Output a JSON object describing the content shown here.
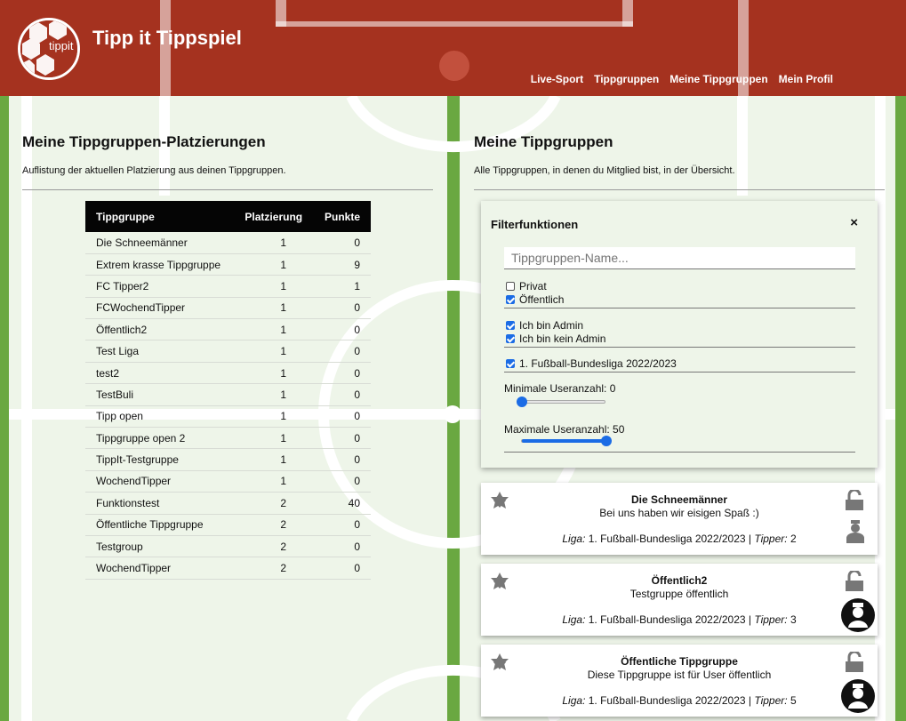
{
  "header": {
    "brand": "Tipp it Tippspiel",
    "logo_text": "tippit",
    "nav": [
      "Live-Sport",
      "Tippgruppen",
      "Meine Tippgruppen",
      "Mein Profil"
    ]
  },
  "left": {
    "title": "Meine Tippgruppen-Platzierungen",
    "subtitle": "Auflistung der aktuellen Platzierung aus deinen Tippgruppen.",
    "columns": [
      "Tippgruppe",
      "Platzierung",
      "Punkte"
    ],
    "rows": [
      [
        "Die Schneemänner",
        "1",
        "0"
      ],
      [
        "Extrem krasse Tippgruppe",
        "1",
        "9"
      ],
      [
        "FC Tipper2",
        "1",
        "1"
      ],
      [
        "FCWochendTipper",
        "1",
        "0"
      ],
      [
        "Öffentlich2",
        "1",
        "0"
      ],
      [
        "Test Liga",
        "1",
        "0"
      ],
      [
        "test2",
        "1",
        "0"
      ],
      [
        "TestBuli",
        "1",
        "0"
      ],
      [
        "Tipp open",
        "1",
        "0"
      ],
      [
        "Tippgruppe open 2",
        "1",
        "0"
      ],
      [
        "TippIt-Testgruppe",
        "1",
        "0"
      ],
      [
        "WochendTipper",
        "1",
        "0"
      ],
      [
        "Funktionstest",
        "2",
        "40"
      ],
      [
        "Öffentliche Tippgruppe",
        "2",
        "0"
      ],
      [
        "Testgroup",
        "2",
        "0"
      ],
      [
        "WochendTipper",
        "2",
        "0"
      ]
    ]
  },
  "right": {
    "title": "Meine Tippgruppen",
    "subtitle": "Alle Tippgruppen, in denen du Mitglied bist, in der Übersicht."
  },
  "filter": {
    "title": "Filterfunktionen",
    "close": "×",
    "search_placeholder": "Tippgruppen-Name...",
    "checkboxes": [
      {
        "label": "Privat",
        "checked": false
      },
      {
        "label": "Öffentlich",
        "checked": true
      },
      {
        "label": "Ich bin Admin",
        "checked": true
      },
      {
        "label": "Ich bin kein Admin",
        "checked": true
      },
      {
        "label": "1. Fußball-Bundesliga 2022/2023",
        "checked": true
      }
    ],
    "min_label": "Minimale Useranzahl: 0",
    "max_label": "Maximale Useranzahl: 50",
    "min_value": 0,
    "max_value": 50,
    "min_fraction": 0.0,
    "max_fraction": 1.0
  },
  "groups": [
    {
      "name": "Die Schneemänner",
      "desc": "Bei uns haben wir eisigen Spaß :)",
      "liga_label": "Liga:",
      "liga": "1. Fußball-Bundesliga 2022/2023",
      "tipper_label": "Tipper:",
      "tipper": "2",
      "role_icon": "person-icon"
    },
    {
      "name": "Öffentlich2",
      "desc": "Testgruppe öffentlich",
      "liga_label": "Liga:",
      "liga": "1. Fußball-Bundesliga 2022/2023",
      "tipper_label": "Tipper:",
      "tipper": "3",
      "role_icon": "admin-avatar-icon"
    },
    {
      "name": "Öffentliche Tippgruppe",
      "desc": "Diese Tippgruppe ist für User öffentlich",
      "liga_label": "Liga:",
      "liga": "1. Fußball-Bundesliga 2022/2023",
      "tipper_label": "Tipper:",
      "tipper": "5",
      "role_icon": "admin-avatar-icon"
    }
  ],
  "colors": {
    "header": "#a5321f",
    "field": "#6aa841",
    "pitch": "#eef5e9",
    "accent": "#1b6ce5"
  }
}
